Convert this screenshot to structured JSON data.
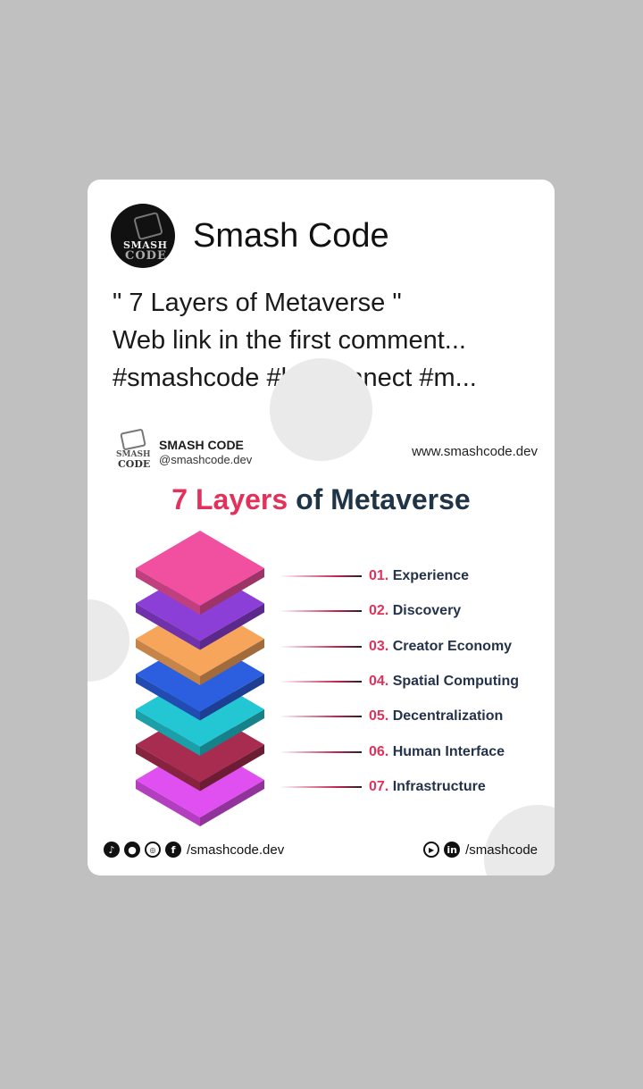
{
  "post": {
    "page_name": "Smash Code",
    "avatar_text_top": "SMASH",
    "avatar_text_bottom": "CODE",
    "text_lines": [
      "\" 7 Layers of Metaverse \"",
      "Web link in the first comment...",
      "#smashcode #letsconnect #m..."
    ]
  },
  "infographic": {
    "brand_title": "SMASH CODE",
    "brand_handle": "@smashcode.dev",
    "logo_text_top": "SMASH",
    "logo_text_bottom": "CODE",
    "website": "www.smashcode.dev",
    "headline_accent": "7 Layers",
    "headline_rest": " of Metaverse",
    "layers": [
      {
        "num": "01.",
        "name": "Experience",
        "color": "#f0509f"
      },
      {
        "num": "02.",
        "name": "Discovery",
        "color": "#8b3fd6"
      },
      {
        "num": "03.",
        "name": "Creator Economy",
        "color": "#f7a55a"
      },
      {
        "num": "04.",
        "name": "Spatial Computing",
        "color": "#2c5fe0"
      },
      {
        "num": "05.",
        "name": "Decentralization",
        "color": "#22c7d3"
      },
      {
        "num": "06.",
        "name": "Human Interface",
        "color": "#a82c4f"
      },
      {
        "num": "07.",
        "name": "Infrastructure",
        "color": "#e04ff0"
      }
    ],
    "footer_left_icons": [
      "tiktok-icon",
      "discord-icon",
      "instagram-icon",
      "facebook-icon"
    ],
    "footer_left_link": "/smashcode.dev",
    "footer_right_icons": [
      "youtube-icon",
      "linkedin-icon"
    ],
    "footer_right_link": "/smashcode"
  }
}
